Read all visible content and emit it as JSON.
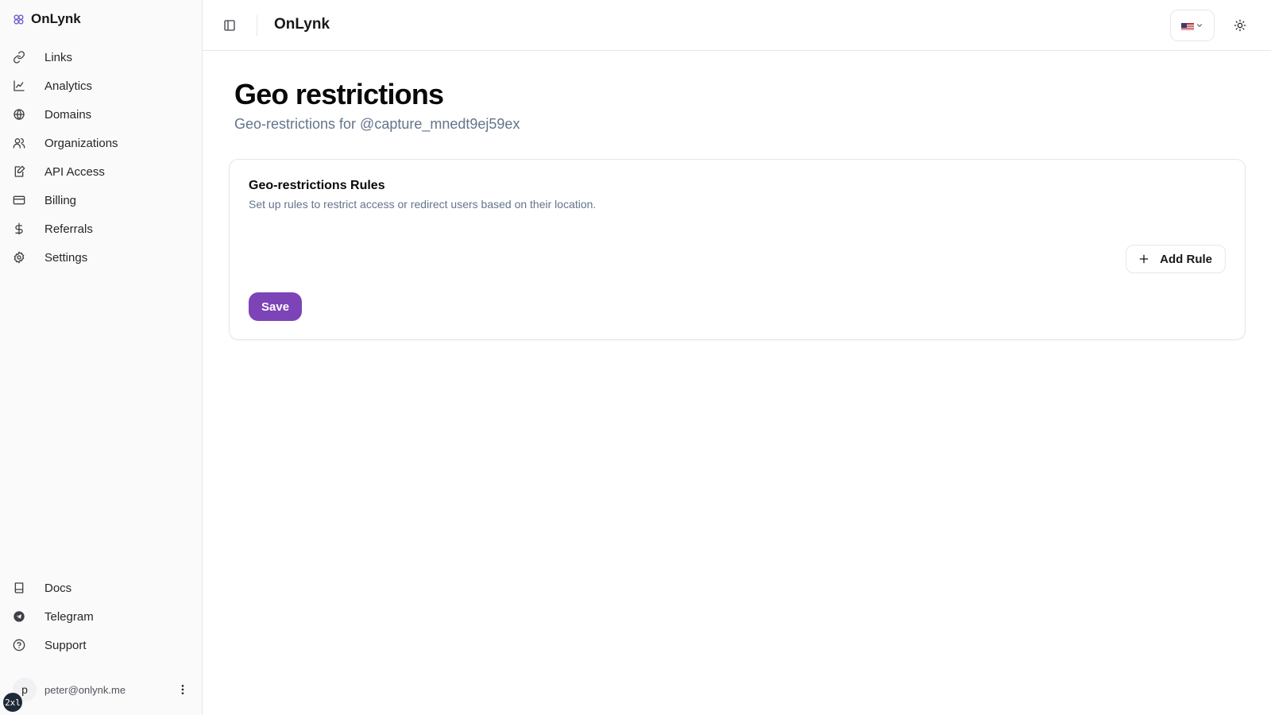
{
  "brand": {
    "name": "OnLynk",
    "icon": "logo-icon"
  },
  "sidebar": {
    "items": [
      {
        "label": "Links",
        "icon": "link-icon"
      },
      {
        "label": "Analytics",
        "icon": "chart-icon"
      },
      {
        "label": "Domains",
        "icon": "globe-icon"
      },
      {
        "label": "Organizations",
        "icon": "users-icon"
      },
      {
        "label": "API Access",
        "icon": "document-edit-icon"
      },
      {
        "label": "Billing",
        "icon": "credit-card-icon"
      },
      {
        "label": "Referrals",
        "icon": "dollar-icon"
      },
      {
        "label": "Settings",
        "icon": "gear-icon"
      }
    ],
    "bottom_items": [
      {
        "label": "Docs",
        "icon": "book-icon"
      },
      {
        "label": "Telegram",
        "icon": "telegram-icon"
      },
      {
        "label": "Support",
        "icon": "help-circle-icon"
      }
    ],
    "user": {
      "avatar_initial": "p",
      "email": "peter@onlynk.me"
    },
    "breakpoint_badge": "2xl"
  },
  "topbar": {
    "title": "OnLynk",
    "language": "en-US flag"
  },
  "page": {
    "title": "Geo restrictions",
    "subtitle": "Geo-restrictions for @capture_mnedt9ej59ex"
  },
  "card": {
    "title": "Geo-restrictions Rules",
    "description": "Set up rules to restrict access or redirect users based on their location.",
    "add_rule_label": "Add Rule",
    "save_label": "Save"
  },
  "colors": {
    "accent": "#7c44b6",
    "brand_icon": "#6d5bd0",
    "muted_text": "#64748b",
    "border": "#e5e7eb"
  }
}
